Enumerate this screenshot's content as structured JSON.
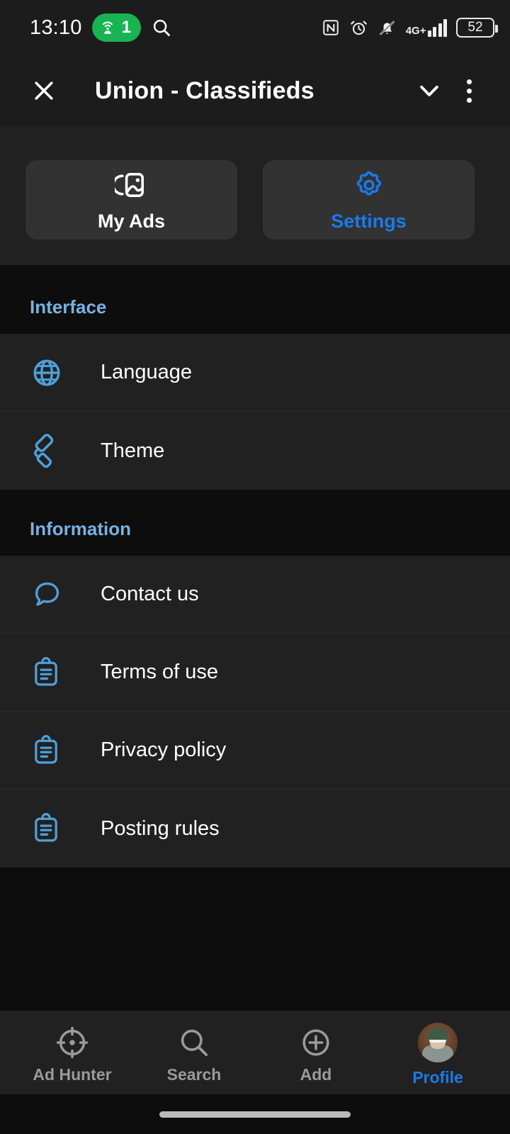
{
  "status_bar": {
    "time": "13:10",
    "hotspot_count": "1",
    "battery_percent": "52",
    "network_label": "4G+",
    "icons": [
      "hotspot-icon",
      "search-icon",
      "nfc-icon",
      "alarm-icon",
      "bell-muted-icon",
      "signal-bars-icon",
      "battery-icon"
    ]
  },
  "app_bar": {
    "title": "Union - Classifieds",
    "close_icon": "close-icon",
    "expand_icon": "chevron-down-icon",
    "overflow_icon": "kebab-menu-icon"
  },
  "tabs": [
    {
      "label": "My Ads",
      "icon": "images-gallery-icon",
      "active": false
    },
    {
      "label": "Settings",
      "icon": "gear-icon",
      "active": true
    }
  ],
  "sections": [
    {
      "header": "Interface",
      "items": [
        {
          "label": "Language",
          "icon": "globe-icon"
        },
        {
          "label": "Theme",
          "icon": "paint-roller-icon"
        }
      ]
    },
    {
      "header": "Information",
      "items": [
        {
          "label": "Contact us",
          "icon": "speech-bubble-icon"
        },
        {
          "label": "Terms of use",
          "icon": "clipboard-icon"
        },
        {
          "label": "Privacy policy",
          "icon": "clipboard-icon"
        },
        {
          "label": "Posting rules",
          "icon": "clipboard-icon"
        }
      ]
    }
  ],
  "bottom_nav": [
    {
      "label": "Ad Hunter",
      "icon": "crosshair-icon",
      "active": false
    },
    {
      "label": "Search",
      "icon": "search-icon",
      "active": false
    },
    {
      "label": "Add",
      "icon": "plus-circle-icon",
      "active": false
    },
    {
      "label": "Profile",
      "icon": "avatar-icon",
      "active": true
    }
  ],
  "colors": {
    "accent_blue": "#1a7ae8",
    "section_header_blue": "#78b2e2",
    "icon_blue": "#4f9fd8",
    "page_bg": "#0d0d0d",
    "row_bg": "#212121",
    "card_bg": "#323232",
    "hotspot_green": "#18b352"
  }
}
